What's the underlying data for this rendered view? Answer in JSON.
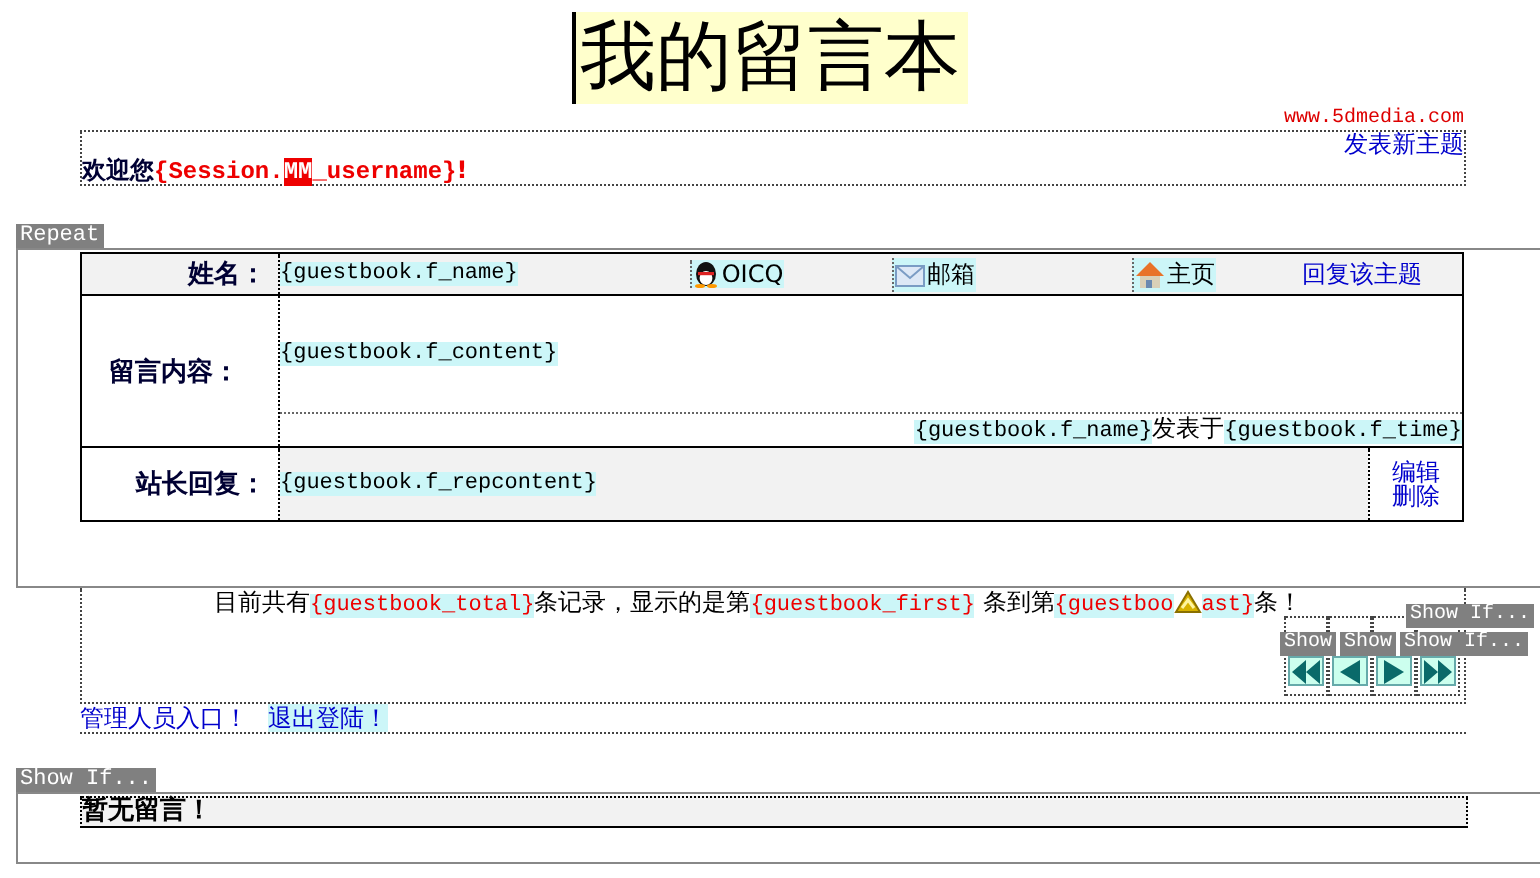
{
  "title": "我的留言本",
  "site_url": "www.5dmedia.com",
  "new_topic_link": "发表新主题",
  "welcome": {
    "label": "欢迎您",
    "parts": [
      {
        "kind": "var",
        "text": "{Session."
      },
      {
        "kind": "mark",
        "text": "MM"
      },
      {
        "kind": "var",
        "text": "_username}"
      }
    ],
    "suffix": "!"
  },
  "repeat_tag": "Repeat",
  "entry": {
    "name_label": "姓名：",
    "name_field": "{guestbook.f_name}",
    "contact_links": [
      {
        "kind": "qq",
        "label": "OICQ"
      },
      {
        "kind": "mail",
        "label": "邮箱"
      },
      {
        "kind": "home",
        "label": "主页"
      }
    ],
    "reply_link": "回复该主题",
    "content_label": "留言内容：",
    "content_field": "{guestbook.f_content}",
    "posted_by": {
      "name": "{guestbook.f_name}",
      "connector": "发表于",
      "time": "{guestbook.f_time}"
    },
    "reply_label": "站长回复：",
    "reply_field": "{guestbook.f_repcontent}",
    "admin_links": [
      "编辑",
      "删除"
    ]
  },
  "stats": [
    {
      "kind": "text",
      "text": "目前共有"
    },
    {
      "kind": "var",
      "text": "{guestbook_total}"
    },
    {
      "kind": "text",
      "text": "条记录，显示的是第"
    },
    {
      "kind": "var",
      "text": "{guestbook_first}"
    },
    {
      "kind": "text",
      "text": " 条到第"
    },
    {
      "kind": "var",
      "text": "{guestboo"
    },
    {
      "kind": "icon"
    },
    {
      "kind": "var",
      "text": "ast}"
    },
    {
      "kind": "text",
      "text": "条！"
    }
  ],
  "nav_buttons": [
    {
      "kind": "first"
    },
    {
      "kind": "prev"
    },
    {
      "kind": "next"
    },
    {
      "kind": "last"
    }
  ],
  "nav_tags": [
    "Show If...",
    "Show",
    "Show",
    "Show If..."
  ],
  "footer_links": [
    {
      "label": "管理人员入口！",
      "highlighted": false
    },
    {
      "label": "退出登陆！",
      "highlighted": true
    }
  ],
  "empty_region": {
    "tag": "Show If...",
    "message": "暂无留言！"
  }
}
